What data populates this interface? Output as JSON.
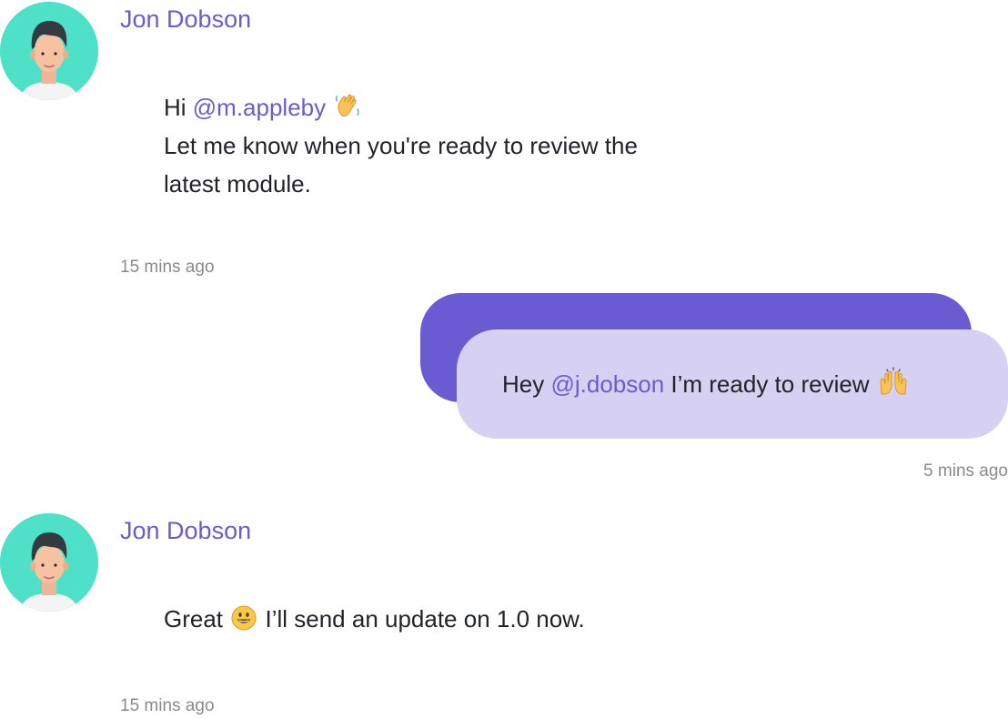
{
  "messages": [
    {
      "sender": "Jon Dobson",
      "line1_prefix": "Hi ",
      "line1_mention": "@m.appleby",
      "line2": "Let me know when you're ready to review the",
      "line3": "latest module.",
      "emoji_icon": "waving-hand-emoji",
      "time": "15 mins ago"
    },
    {
      "prefix": "Hey ",
      "mention": "@j.dobson",
      "suffix": " I’m ready to review ",
      "emoji_icon": "raising-hands-emoji",
      "time": "5 mins ago"
    },
    {
      "sender": "Jon Dobson",
      "prefix": "Great ",
      "suffix": " I’ll send an update on 1.0 now.",
      "emoji_icon": "smiling-face-emoji",
      "time": "15 mins ago"
    }
  ],
  "colors": {
    "accent": "#6b5bd3",
    "bubble_light": "#d6d0f3",
    "avatar_bg": "#4fe0c8",
    "timestamp": "#8a8a8a"
  }
}
